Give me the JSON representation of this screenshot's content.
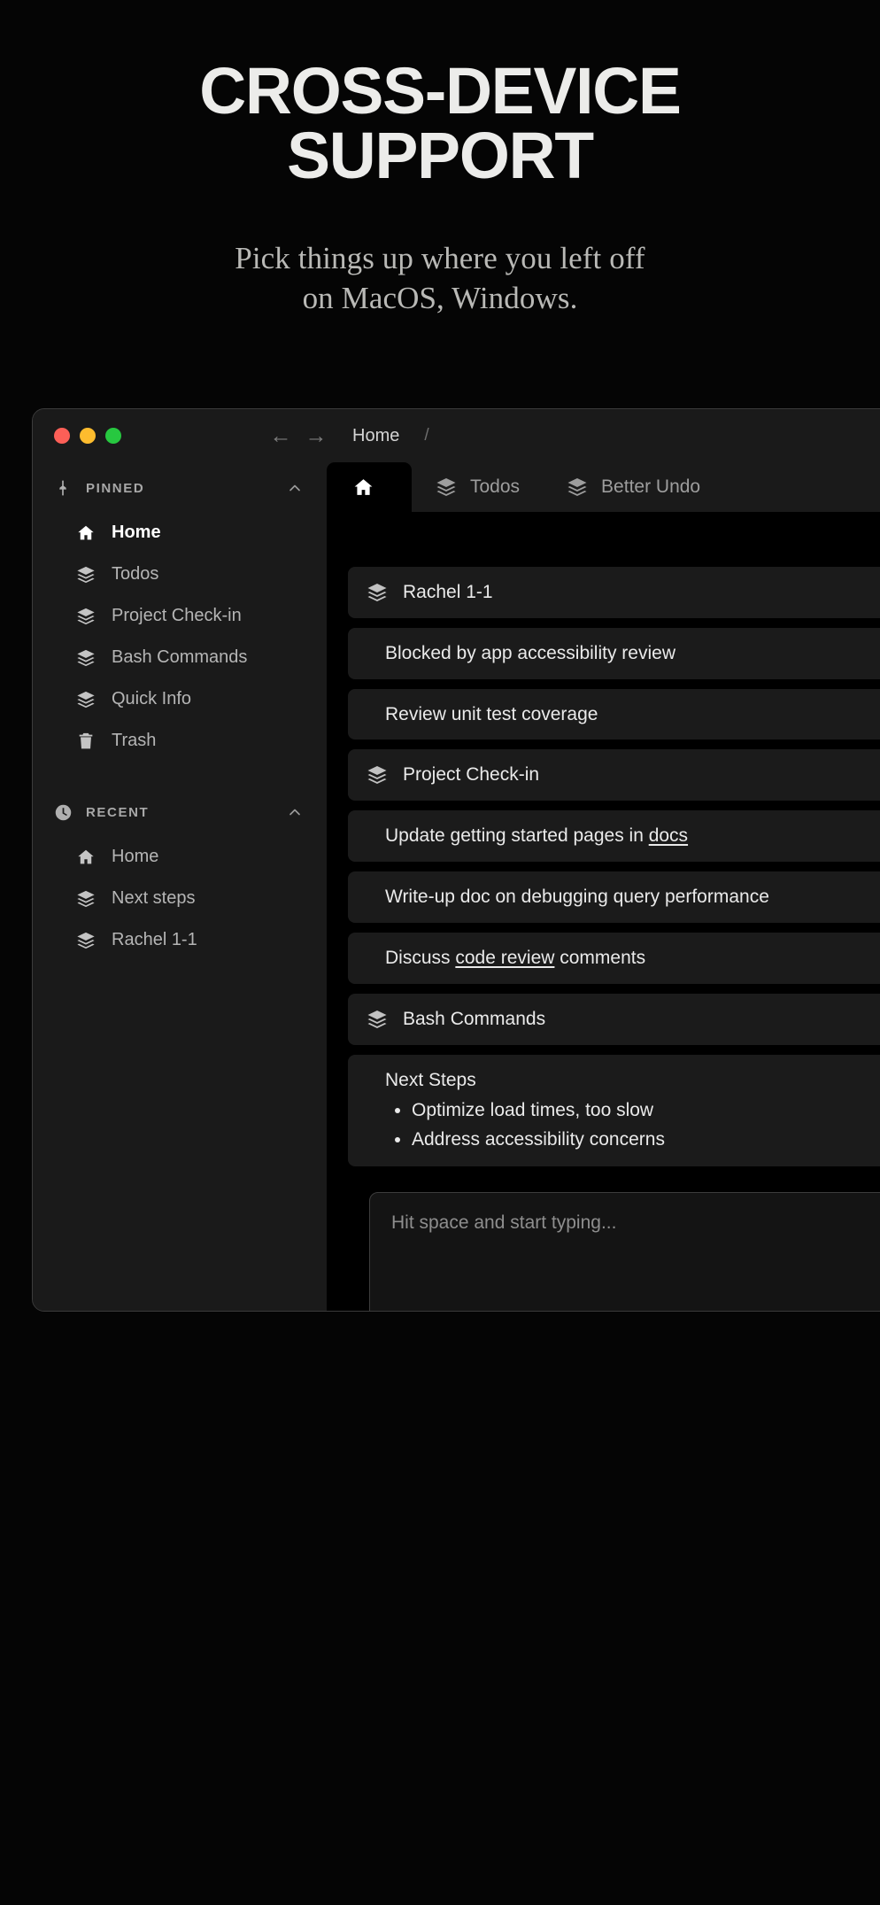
{
  "hero": {
    "title": "CROSS-DEVICE SUPPORT",
    "subtitle_line1": "Pick things up where you left off",
    "subtitle_line2": "on MacOS, Windows."
  },
  "window": {
    "traffic_lights": {
      "close_label": "close",
      "minimize_label": "minimize",
      "maximize_label": "maximize",
      "close_color": "#fc5f57",
      "minimize_color": "#fdbc2e",
      "maximize_color": "#27c840"
    },
    "nav": {
      "back_icon": "←",
      "forward_icon": "→"
    },
    "breadcrumb": {
      "current": "Home",
      "separator": "/"
    }
  },
  "sidebar": {
    "sections": [
      {
        "label": "PINNED",
        "icon": "pin-icon",
        "chevron": "chevron-up-icon",
        "items": [
          {
            "label": "Home",
            "icon": "home-icon",
            "active": true
          },
          {
            "label": "Todos",
            "icon": "layers-icon",
            "active": false
          },
          {
            "label": "Project Check-in",
            "icon": "layers-icon",
            "active": false
          },
          {
            "label": "Bash Commands",
            "icon": "layers-icon",
            "active": false
          },
          {
            "label": "Quick Info",
            "icon": "layers-icon",
            "active": false
          },
          {
            "label": "Trash",
            "icon": "trash-icon",
            "active": false
          }
        ]
      },
      {
        "label": "RECENT",
        "icon": "clock-icon",
        "chevron": "chevron-up-icon",
        "items": [
          {
            "label": "Home",
            "icon": "home-icon",
            "active": false
          },
          {
            "label": "Next steps",
            "icon": "layers-icon",
            "active": false
          },
          {
            "label": "Rachel 1-1",
            "icon": "layers-icon",
            "active": false
          }
        ]
      }
    ]
  },
  "tabs": [
    {
      "label": "",
      "icon": "home-icon",
      "active": true
    },
    {
      "label": "Todos",
      "icon": "layers-icon",
      "active": false
    },
    {
      "label": "Better Undo",
      "icon": "layers-icon",
      "active": false
    }
  ],
  "content": {
    "rows": [
      {
        "type": "header",
        "icon": "layers-icon",
        "text": "Rachel 1-1"
      },
      {
        "type": "item",
        "text": "Blocked by app accessibility review"
      },
      {
        "type": "item",
        "text": "Review unit test coverage"
      },
      {
        "type": "header",
        "icon": "layers-icon",
        "text": "Project Check-in"
      },
      {
        "type": "item_link",
        "prefix": "Update getting started pages in ",
        "link": "docs",
        "suffix": ""
      },
      {
        "type": "item",
        "text": "Write-up doc on debugging query performance"
      },
      {
        "type": "item_link",
        "prefix": "Discuss ",
        "link": "code review",
        "suffix": " comments"
      },
      {
        "type": "header",
        "icon": "layers-icon",
        "text": "Bash Commands"
      },
      {
        "type": "bullets",
        "text": "Next Steps",
        "bullets": [
          "Optimize load times, too slow",
          "Address accessibility concerns"
        ]
      }
    ]
  },
  "composer": {
    "placeholder": "Hit space and start typing...",
    "tools": [
      {
        "name": "resize-vertical-icon"
      },
      {
        "name": "return-icon"
      },
      {
        "name": "emoji-icon"
      },
      {
        "name": "attachment-icon"
      }
    ]
  },
  "colors": {
    "page_bg": "#050505",
    "window_bg": "#1a1a1a",
    "main_bg": "#000000",
    "card_bg": "#1b1b1b",
    "text_primary": "#eaeaea",
    "text_muted": "#9d9d9d"
  }
}
